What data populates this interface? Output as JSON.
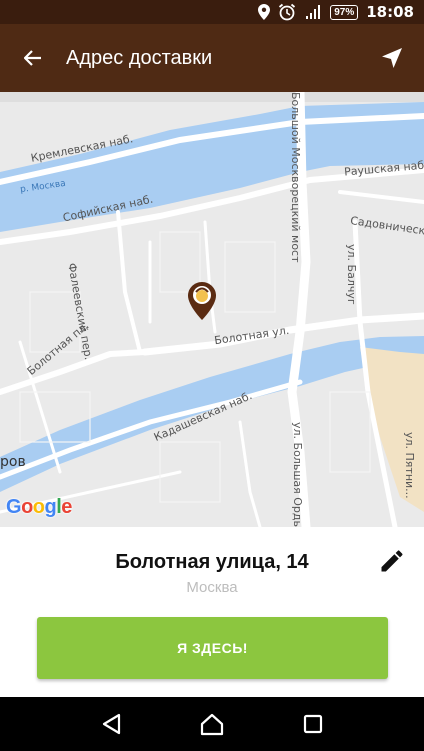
{
  "status_bar": {
    "battery": "97%",
    "time": "18:08",
    "icons": [
      "location-icon",
      "alarm-icon",
      "signal-icon",
      "battery-icon"
    ]
  },
  "app_bar": {
    "title": "Адрес доставки",
    "back_icon": "arrow-left-icon",
    "locate_icon": "navigation-arrow-icon"
  },
  "map": {
    "labels": {
      "kremlevskaya": "Кремлевская наб.",
      "moskva_river": "р. Москва",
      "sofiyskaya": "Софийская наб.",
      "faleevsky": "Фалеевский пер.",
      "bolotnaya_pl": "Болотная пл.",
      "bolotnaya_ul": "Болотная ул.",
      "bolshoy_moskvoretsky": "Большой Москворецкий мост",
      "raushskaya": "Раушская наб.",
      "sadovnicheskaya": "Садовническ...",
      "balchug": "ул. Балчуг",
      "kadashevskaya": "Кадашевская наб.",
      "bolshaya_ordynka": "ул. Большая Орды...",
      "pyatnitskaya": "ул. Пятни...",
      "rov": "ров"
    },
    "attribution": [
      "G",
      "o",
      "o",
      "g",
      "l",
      "e"
    ],
    "colors": {
      "water": "#a9cdf2",
      "land": "#eaeaea",
      "road": "#ffffff",
      "sand": "#f2e2c4",
      "marker": "#5a2b12"
    }
  },
  "address": {
    "street": "Болотная улица, 14",
    "city": "Москва",
    "edit_icon": "pencil-icon"
  },
  "confirm_button": {
    "label": "Я ЗДЕСЬ!",
    "color": "#8cc63f"
  },
  "nav_bar": {
    "icons": [
      "back-triangle-icon",
      "home-icon",
      "recents-icon"
    ]
  }
}
